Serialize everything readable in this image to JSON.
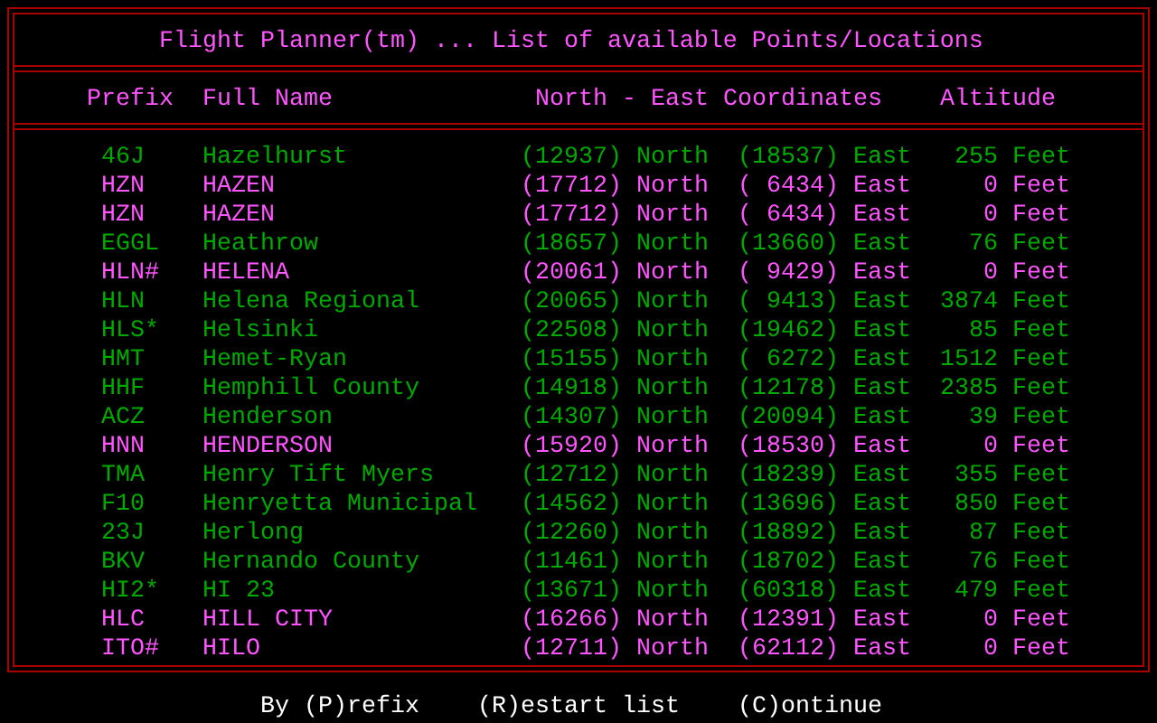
{
  "title": "Flight Planner(tm) ... List of available Points/Locations",
  "columns": [
    "Prefix",
    "Full Name",
    "North - East Coordinates",
    "Altitude"
  ],
  "rows": [
    {
      "prefix": "46J",
      "name": "Hazelhurst",
      "north": "(12937) North",
      "east": "(18537) East",
      "altitude": "255 Feet",
      "color": "#00aa00"
    },
    {
      "prefix": "HZN",
      "name": "HAZEN",
      "north": "(17712) North",
      "east": "( 6434) East",
      "altitude": "0 Feet",
      "color": "#ff55ff"
    },
    {
      "prefix": "HZN",
      "name": "HAZEN",
      "north": "(17712) North",
      "east": "( 6434) East",
      "altitude": "0 Feet",
      "color": "#ff55ff"
    },
    {
      "prefix": "EGGL",
      "name": "Heathrow",
      "north": "(18657) North",
      "east": "(13660) East",
      "altitude": "76 Feet",
      "color": "#00aa00"
    },
    {
      "prefix": "HLN#",
      "name": "HELENA",
      "north": "(20061) North",
      "east": "( 9429) East",
      "altitude": "0 Feet",
      "color": "#ff55ff"
    },
    {
      "prefix": "HLN",
      "name": "Helena Regional",
      "north": "(20065) North",
      "east": "( 9413) East",
      "altitude": "3874 Feet",
      "color": "#00aa00"
    },
    {
      "prefix": "HLS*",
      "name": "Helsinki",
      "north": "(22508) North",
      "east": "(19462) East",
      "altitude": "85 Feet",
      "color": "#00aa00"
    },
    {
      "prefix": "HMT",
      "name": "Hemet-Ryan",
      "north": "(15155) North",
      "east": "( 6272) East",
      "altitude": "1512 Feet",
      "color": "#00aa00"
    },
    {
      "prefix": "HHF",
      "name": "Hemphill County",
      "north": "(14918) North",
      "east": "(12178) East",
      "altitude": "2385 Feet",
      "color": "#00aa00"
    },
    {
      "prefix": "ACZ",
      "name": "Henderson",
      "north": "(14307) North",
      "east": "(20094) East",
      "altitude": "39 Feet",
      "color": "#00aa00"
    },
    {
      "prefix": "HNN",
      "name": "HENDERSON",
      "north": "(15920) North",
      "east": "(18530) East",
      "altitude": "0 Feet",
      "color": "#ff55ff"
    },
    {
      "prefix": "TMA",
      "name": "Henry Tift Myers",
      "north": "(12712) North",
      "east": "(18239) East",
      "altitude": "355 Feet",
      "color": "#00aa00"
    },
    {
      "prefix": "F10",
      "name": "Henryetta Municipal",
      "north": "(14562) North",
      "east": "(13696) East",
      "altitude": "850 Feet",
      "color": "#00aa00"
    },
    {
      "prefix": "23J",
      "name": "Herlong",
      "north": "(12260) North",
      "east": "(18892) East",
      "altitude": "87 Feet",
      "color": "#00aa00"
    },
    {
      "prefix": "BKV",
      "name": "Hernando County",
      "north": "(11461) North",
      "east": "(18702) East",
      "altitude": "76 Feet",
      "color": "#00aa00"
    },
    {
      "prefix": "HI2*",
      "name": "HI 23",
      "north": "(13671) North",
      "east": "(60318) East",
      "altitude": "479 Feet",
      "color": "#00aa00"
    },
    {
      "prefix": "HLC",
      "name": "HILL CITY",
      "north": "(16266) North",
      "east": "(12391) East",
      "altitude": "0 Feet",
      "color": "#ff55ff"
    },
    {
      "prefix": "ITO#",
      "name": "HILO",
      "north": "(12711) North",
      "east": "(62112) East",
      "altitude": "0 Feet",
      "color": "#ff55ff"
    }
  ],
  "commands": [
    "By (P)refix",
    "(R)estart list",
    "(C)ontinue"
  ]
}
